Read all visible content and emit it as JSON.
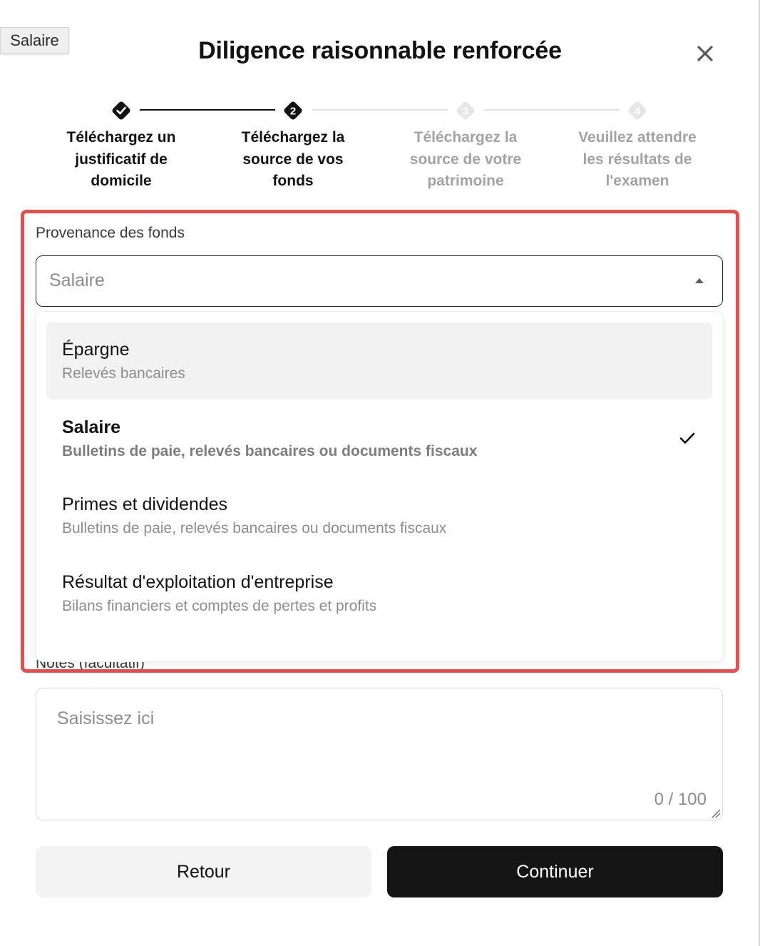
{
  "tooltip": {
    "text": "Salaire"
  },
  "dialog": {
    "title": "Diligence raisonnable renforcée",
    "close_icon": "close-icon"
  },
  "stepper": {
    "steps": [
      {
        "marker": "✓",
        "label_lines": [
          "Téléchargez un",
          "justificatif de",
          "domicile"
        ],
        "state": "completed"
      },
      {
        "marker": "2",
        "label_lines": [
          "Téléchargez la",
          "source de vos",
          "fonds"
        ],
        "state": "active"
      },
      {
        "marker": "3",
        "label_lines": [
          "Téléchargez la",
          "source de votre",
          "patrimoine"
        ],
        "state": "inactive"
      },
      {
        "marker": "4",
        "label_lines": [
          "Veuillez attendre",
          "les résultats de",
          "l'examen"
        ],
        "state": "inactive"
      }
    ]
  },
  "funds": {
    "label": "Provenance des fonds",
    "selected": "Salaire",
    "options": [
      {
        "title": "Épargne",
        "subtitle": "Relevés bancaires",
        "state": "hover"
      },
      {
        "title": "Salaire",
        "subtitle": "Bulletins de paie, relevés bancaires ou documents fiscaux",
        "state": "selected"
      },
      {
        "title": "Primes et dividendes",
        "subtitle": "Bulletins de paie, relevés bancaires ou documents fiscaux",
        "state": "default"
      },
      {
        "title": "Résultat d'exploitation d'entreprise",
        "subtitle": "Bilans financiers et comptes de pertes et profits",
        "state": "default"
      }
    ]
  },
  "notes": {
    "label": "Notes (facultatif)",
    "placeholder": "Saisissez ici",
    "counter": "0 / 100"
  },
  "actions": {
    "back_label": "Retour",
    "continue_label": "Continuer"
  },
  "colors": {
    "highlight": "#e84d4f",
    "primary_button": "#151515",
    "inactive_step": "#a3a3a3"
  }
}
